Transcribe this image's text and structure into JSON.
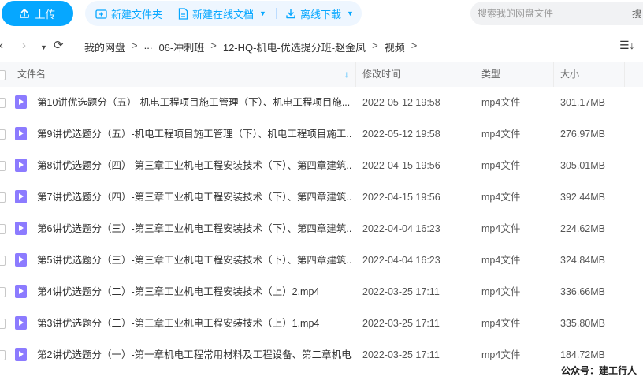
{
  "toolbar": {
    "upload_label": "上传",
    "new_folder_label": "新建文件夹",
    "new_online_doc_label": "新建在线文档",
    "offline_download_label": "离线下载",
    "search_placeholder": "搜索我的网盘文件",
    "search_button_label": "搜",
    "accent_color": "#06a7ff"
  },
  "nav": {
    "back_icon": "chevron-left-icon",
    "forward_icon": "chevron-right-icon",
    "refresh_icon": "refresh-icon",
    "breadcrumb": [
      "我的网盘",
      "...",
      "06-冲刺班",
      "12-HQ-机电-优选提分班-赵金凤",
      "视频"
    ]
  },
  "table": {
    "columns": {
      "name": "文件名",
      "modified": "修改时间",
      "type": "类型",
      "size": "大小"
    },
    "rows": [
      {
        "name": "第10讲优选题分（五）-机电工程项目施工管理（下）、机电工程项目施...",
        "modified": "2022-05-12 19:58",
        "type": "mp4文件",
        "size": "301.17MB"
      },
      {
        "name": "第9讲优选题分（五）-机电工程项目施工管理（下）、机电工程项目施工...",
        "modified": "2022-05-12 19:58",
        "type": "mp4文件",
        "size": "276.97MB"
      },
      {
        "name": "第8讲优选题分（四）-第三章工业机电工程安装技术（下）、第四章建筑...",
        "modified": "2022-04-15 19:56",
        "type": "mp4文件",
        "size": "305.01MB"
      },
      {
        "name": "第7讲优选题分（四）-第三章工业机电工程安装技术（下）、第四章建筑...",
        "modified": "2022-04-15 19:56",
        "type": "mp4文件",
        "size": "392.44MB"
      },
      {
        "name": "第6讲优选题分（三）-第三章工业机电工程安装技术（下）、第四章建筑...",
        "modified": "2022-04-04 16:23",
        "type": "mp4文件",
        "size": "224.62MB"
      },
      {
        "name": "第5讲优选题分（三）-第三章工业机电工程安装技术（下）、第四章建筑...",
        "modified": "2022-04-04 16:23",
        "type": "mp4文件",
        "size": "324.84MB"
      },
      {
        "name": "第4讲优选题分（二）-第三章工业机电工程安装技术（上）2.mp4",
        "modified": "2022-03-25 17:11",
        "type": "mp4文件",
        "size": "336.66MB"
      },
      {
        "name": "第3讲优选题分（二）-第三章工业机电工程安装技术（上）1.mp4",
        "modified": "2022-03-25 17:11",
        "type": "mp4文件",
        "size": "335.80MB"
      },
      {
        "name": "第2讲优选题分（一）-第一章机电工程常用材料及工程设备、第二章机电...",
        "modified": "2022-03-25 17:11",
        "type": "mp4文件",
        "size": "184.72MB"
      }
    ]
  },
  "watermark": "公众号：建工行人"
}
